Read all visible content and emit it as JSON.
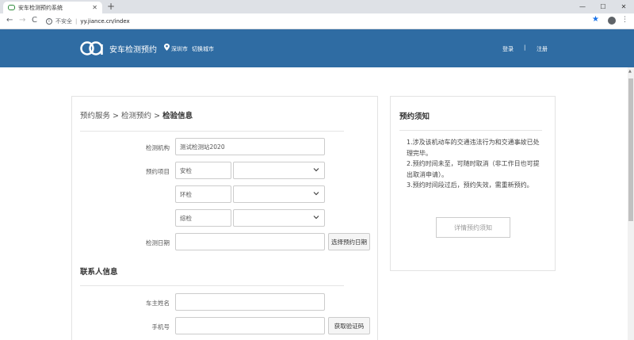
{
  "browser": {
    "tab_title": "安车检测预约系统",
    "tab_close": "✕",
    "new_tab": "+",
    "minimize": "—",
    "maximize": "☐",
    "close": "✕",
    "back": "←",
    "forward": "→",
    "reload": "C",
    "insecure_label": "不安全",
    "separator": "|",
    "url": "yy.jiance.cn/index",
    "star": "★",
    "menu": "⋮"
  },
  "header": {
    "logo_text": "安车检测预约",
    "city": "深圳市",
    "switch_city": "切换城市",
    "login": "登录",
    "divider": "|",
    "register": "注册",
    "bg_color": "#2f6ca3"
  },
  "form": {
    "breadcrumb": {
      "part1": "预约服务",
      "sep": ">",
      "part2": "检测预约",
      "current": "检验信息"
    },
    "station_label": "检测机构",
    "station_value": "测试检测站2020",
    "items_label": "预约项目",
    "item1": "安检",
    "item2": "环检",
    "item3": "综检",
    "date_label": "检测日期",
    "date_button": "选择预约日期",
    "contact_title": "联系人信息",
    "owner_label": "车主姓名",
    "phone_label": "手机号",
    "code_button": "获取验证码"
  },
  "notice": {
    "title": "预约须知",
    "line1": "1.涉及该机动车的交通违法行为和交通事故已处理完毕。",
    "line2": "2.预约时间未至，可随时取消（非工作日也可提出取消申请）。",
    "line3": "3.预约时间段过后，预约失效，需重新预约。",
    "detail_button": "详情预约须知"
  }
}
